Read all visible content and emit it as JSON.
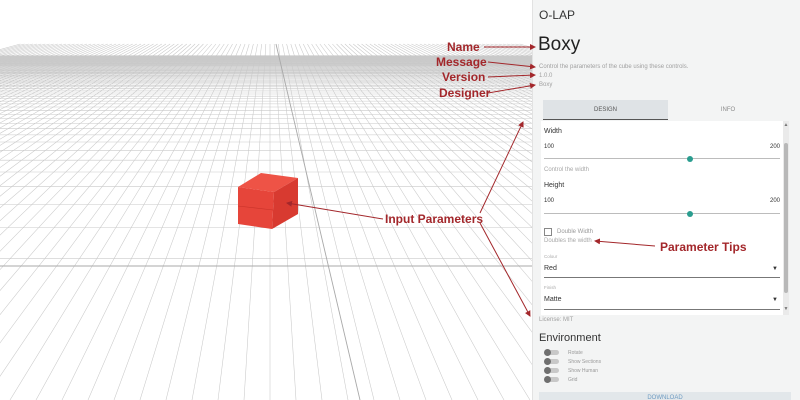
{
  "app": {
    "name": "O-LAP"
  },
  "model": {
    "name": "Boxy",
    "message": "Control the parameters of the cube using these controls.",
    "version": "1.0.0",
    "designer": "Boxy"
  },
  "tabs": {
    "design": "DESIGN",
    "info": "INFO"
  },
  "params": {
    "width": {
      "label": "Width",
      "min": "100",
      "max": "200",
      "value": 0.62,
      "tip": "Control the width"
    },
    "height": {
      "label": "Height",
      "min": "100",
      "max": "200",
      "value": 0.62
    },
    "double_width": {
      "label": "Double Width",
      "tip": "Doubles the width",
      "checked": false
    },
    "colour": {
      "caption": "Colour",
      "value": "Red"
    },
    "finish": {
      "caption": "Finish",
      "value": "Matte"
    }
  },
  "license": "License: MIT",
  "environment": {
    "title": "Environment",
    "toggles": [
      "Rotate",
      "Show Sections",
      "Show Human",
      "Grid"
    ]
  },
  "download": "DOWNLOAD",
  "annotations": {
    "name": "Name",
    "message": "Message",
    "version": "Version",
    "designer": "Designer",
    "input_parameters": "Input Parameters",
    "parameter_tips": "Parameter Tips"
  },
  "colors": {
    "cube": "#e8463b",
    "accent": "#2a9d8f",
    "annotation": "#a3272b"
  },
  "icons": {
    "dropdown": "caret-down-icon"
  }
}
